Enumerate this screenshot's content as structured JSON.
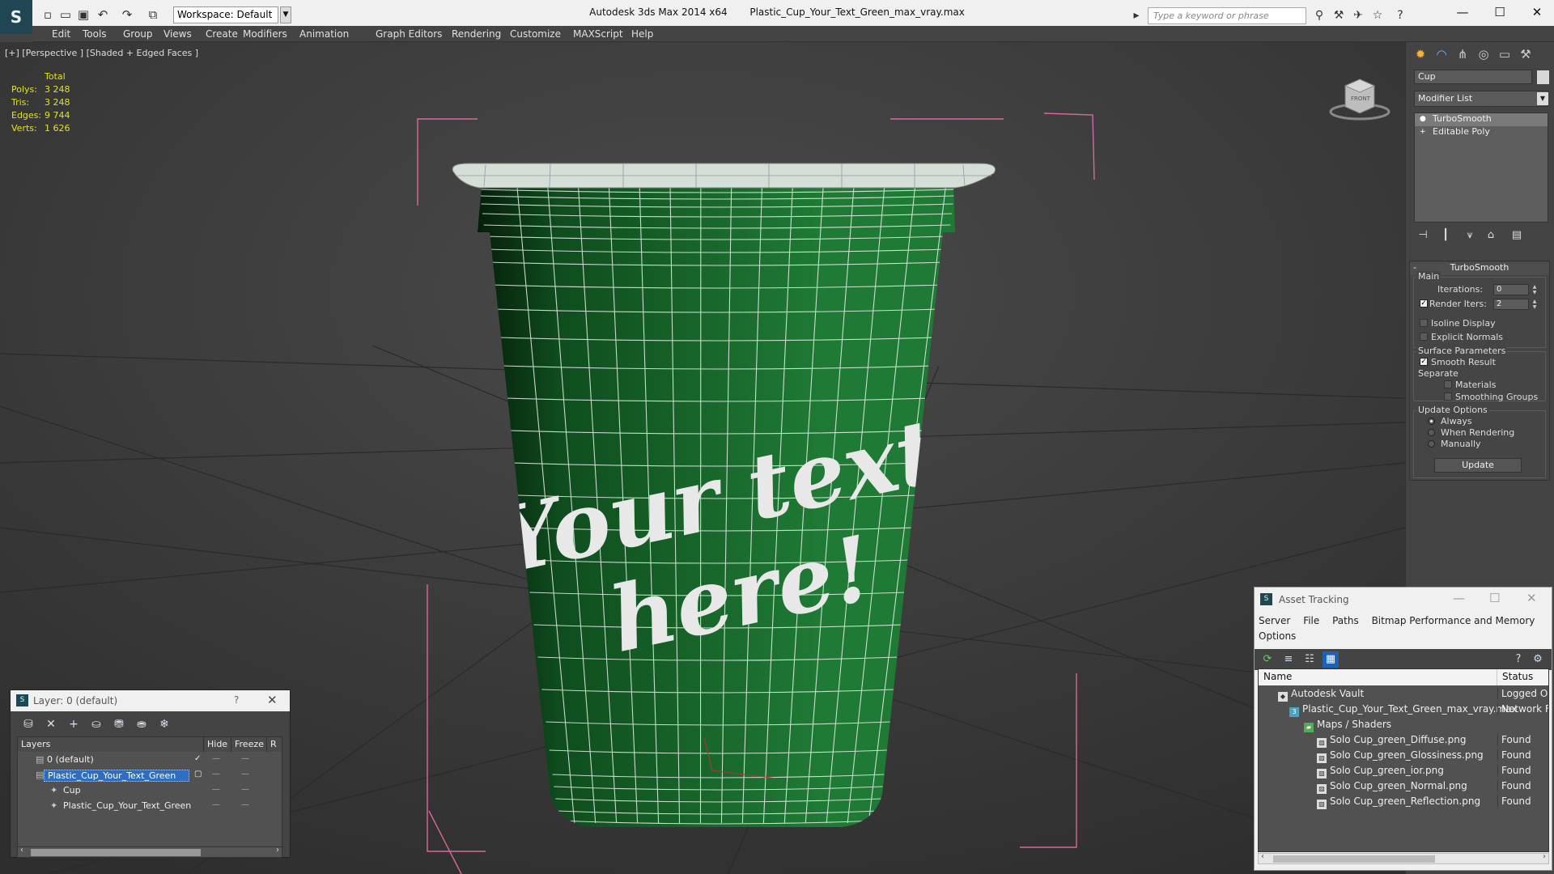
{
  "titlebar": {
    "app_title": "Autodesk 3ds Max  2014 x64",
    "file_name": "Plastic_Cup_Your_Text_Green_max_vray.max",
    "workspace": "Workspace: Default",
    "search_placeholder": "Type a keyword or phrase"
  },
  "menu": [
    "Edit",
    "Tools",
    "Group",
    "Views",
    "Create",
    "Modifiers",
    "Animation",
    "Graph Editors",
    "Rendering",
    "Customize",
    "MAXScript",
    "Help"
  ],
  "viewport": {
    "label": "[+] [Perspective ] [Shaded + Edged Faces ]",
    "stats": {
      "header": "Total",
      "rows": [
        {
          "k": "Polys:",
          "v": "3 248"
        },
        {
          "k": "Tris:",
          "v": "3 248"
        },
        {
          "k": "Edges:",
          "v": "9 744"
        },
        {
          "k": "Verts:",
          "v": "1 626"
        }
      ]
    },
    "cup_text_line1": "Your text",
    "cup_text_line2": "here!",
    "cup_color": "#1f7a35",
    "cup_dark": "#0f4d1e",
    "wire_color": "#e8f0e8",
    "bbox_color": "#d9689a",
    "viewcube_label": "FRONT"
  },
  "command_panel": {
    "object_name": "Cup",
    "modifier_list": "Modifier List",
    "stack": [
      {
        "label": "TurboSmooth",
        "selected": true
      },
      {
        "label": "Editable Poly",
        "selected": false
      }
    ],
    "turbosmooth": {
      "title": "TurboSmooth",
      "main": "Main",
      "iterations_label": "Iterations:",
      "iterations": "0",
      "render_iters_label": "Render Iters:",
      "render_iters": "2",
      "isoline": "Isoline Display",
      "explicit_normals": "Explicit Normals",
      "surface_params": "Surface Parameters",
      "smooth_result": "Smooth Result",
      "separate": "Separate",
      "materials": "Materials",
      "smoothing_groups": "Smoothing Groups",
      "update_options": "Update Options",
      "always": "Always",
      "when_rendering": "When Rendering",
      "manually": "Manually",
      "update_btn": "Update"
    }
  },
  "layer_window": {
    "title": "Layer: 0 (default)",
    "help": "?",
    "columns": [
      "Layers",
      "Hide",
      "Freeze",
      "R"
    ],
    "rows": [
      {
        "name": "0 (default)",
        "indent": 1,
        "selected": false
      },
      {
        "name": "Plastic_Cup_Your_Text_Green",
        "indent": 1,
        "selected": true
      },
      {
        "name": "Cup",
        "indent": 2,
        "selected": false
      },
      {
        "name": "Plastic_Cup_Your_Text_Green",
        "indent": 2,
        "selected": false
      }
    ]
  },
  "asset_tracking": {
    "title": "Asset Tracking",
    "menu": [
      "Server",
      "File",
      "Paths",
      "Bitmap Performance and Memory",
      "Options"
    ],
    "columns": [
      "Name",
      "Status"
    ],
    "rows": [
      {
        "name": "Autodesk Vault",
        "status": "Logged O",
        "indent": 1
      },
      {
        "name": "Plastic_Cup_Your_Text_Green_max_vray.max",
        "status": "Network F",
        "indent": 2
      },
      {
        "name": "Maps / Shaders",
        "status": "",
        "indent": 3
      },
      {
        "name": "Solo Cup_green_Diffuse.png",
        "status": "Found",
        "indent": 4
      },
      {
        "name": "Solo Cup_green_Glossiness.png",
        "status": "Found",
        "indent": 4
      },
      {
        "name": "Solo Cup_green_ior.png",
        "status": "Found",
        "indent": 4
      },
      {
        "name": "Solo Cup_green_Normal.png",
        "status": "Found",
        "indent": 4
      },
      {
        "name": "Solo Cup_green_Reflection.png",
        "status": "Found",
        "indent": 4
      }
    ]
  }
}
